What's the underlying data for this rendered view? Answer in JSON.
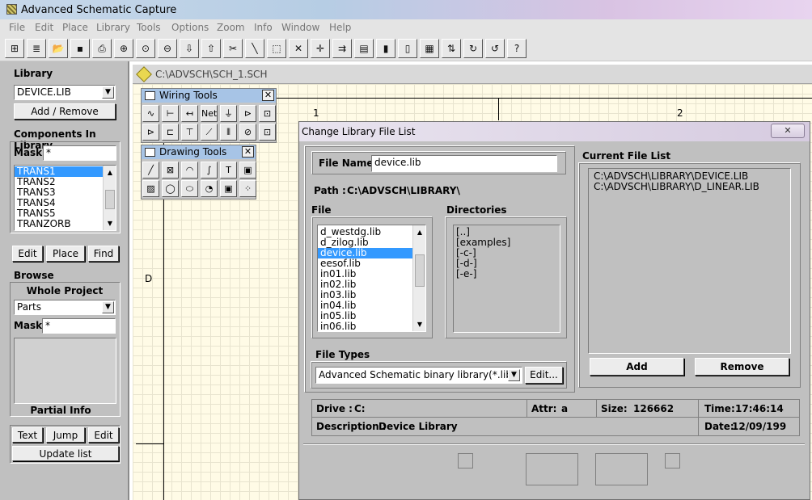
{
  "app": {
    "title": "Advanced Schematic Capture"
  },
  "menu": [
    "File",
    "Edit",
    "Place",
    "Library",
    "Tools",
    "Options",
    "Zoom",
    "Info",
    "Window",
    "Help"
  ],
  "toolbar_icons": [
    "hierarchy-icon",
    "stack-icon",
    "open-folder-icon",
    "save-disk-icon",
    "print-icon",
    "zoom-in-icon",
    "zoom-fit-icon",
    "zoom-out-icon",
    "arrow-down-icon",
    "arrow-up-icon",
    "scissors-icon",
    "wire-tool-icon",
    "select-box-icon",
    "cross-tool-icon",
    "move-tool-icon",
    "component-icon",
    "chip-icon",
    "book-icon",
    "book-open-icon",
    "grid-icon",
    "sort-icon",
    "rotate-icon",
    "rotate-back-icon",
    "help-icon"
  ],
  "toolbar_glyphs": [
    "⊞",
    "≣",
    "📂",
    "▪",
    "⎙",
    "⊕",
    "⊙",
    "⊖",
    "⇩",
    "⇧",
    "✂",
    "╲",
    "⬚",
    "✕",
    "✛",
    "⇉",
    "▤",
    "▮",
    "▯",
    "▦",
    "⇅",
    "↻",
    "↺",
    "?"
  ],
  "sidebar": {
    "library_label": "Library",
    "library_value": "DEVICE.LIB",
    "add_remove": "Add / Remove",
    "components_label": "Components In Library",
    "mask_label": "Mask",
    "mask_value": "*",
    "components": [
      "TRANS1",
      "TRANS2",
      "TRANS3",
      "TRANS4",
      "TRANS5",
      "TRANZORB"
    ],
    "edit": "Edit",
    "place": "Place",
    "find": "Find",
    "browse_label": "Browse",
    "whole_project": "Whole Project",
    "browse_value": "Parts",
    "browse_mask_label": "Mask",
    "browse_mask_value": "*",
    "partial_info": "Partial Info",
    "text": "Text",
    "jump": "Jump",
    "edit2": "Edit",
    "update_list": "Update list"
  },
  "document": {
    "title": "C:\\ADVSCH\\SCH_1.SCH",
    "col1": "1",
    "col2": "2",
    "row_d": "D"
  },
  "wiring_tools": {
    "title": "Wiring Tools",
    "close": "✕",
    "glyphs": [
      "∿",
      "⊢",
      "↤",
      "Net",
      "⏚",
      "⊳",
      "⊡",
      "⊳",
      "⊏",
      "⊤",
      "⟋",
      "⦀",
      "⊘",
      "⊡"
    ]
  },
  "drawing_tools": {
    "title": "Drawing Tools",
    "close": "✕",
    "glyphs": [
      "╱",
      "⊠",
      "◠",
      "∫",
      "T",
      "▣",
      "▨",
      "◯",
      "⬭",
      "◔",
      "▣",
      "⁘"
    ]
  },
  "dialog": {
    "title": "Change Library File List",
    "close": "✕",
    "file_name_label": "File Name",
    "file_name_value": "device.lib",
    "path_label": "Path :",
    "path_value": "C:\\ADVSCH\\LIBRARY\\",
    "file_label": "File",
    "files": [
      "d_westdg.lib",
      "d_zilog.lib",
      "device.lib",
      "eesof.lib",
      "in01.lib",
      "in02.lib",
      "in03.lib",
      "in04.lib",
      "in05.lib",
      "in06.lib"
    ],
    "directories_label": "Directories",
    "directories": [
      "[..]",
      "[examples]",
      "[-c-]",
      "[-d-]",
      "[-e-]"
    ],
    "file_types_label": "File Types",
    "file_types_value": "Advanced Schematic binary library(*.lib)",
    "edit_button": "Edit...",
    "current_list_label": "Current File List",
    "current_files": [
      "C:\\ADVSCH\\LIBRARY\\DEVICE.LIB",
      "C:\\ADVSCH\\LIBRARY\\D_LINEAR.LIB"
    ],
    "add": "Add",
    "remove": "Remove",
    "drive_label": "Drive :",
    "drive_value": "C:",
    "attr_label": "Attr:",
    "attr_value": "a",
    "size_label": "Size:",
    "size_value": "126662",
    "time_label": "Time:",
    "time_value": "17:46:14",
    "description_label": "Description :",
    "description_value": "Device Library",
    "date_label": "Date:",
    "date_value": "12/09/199"
  }
}
